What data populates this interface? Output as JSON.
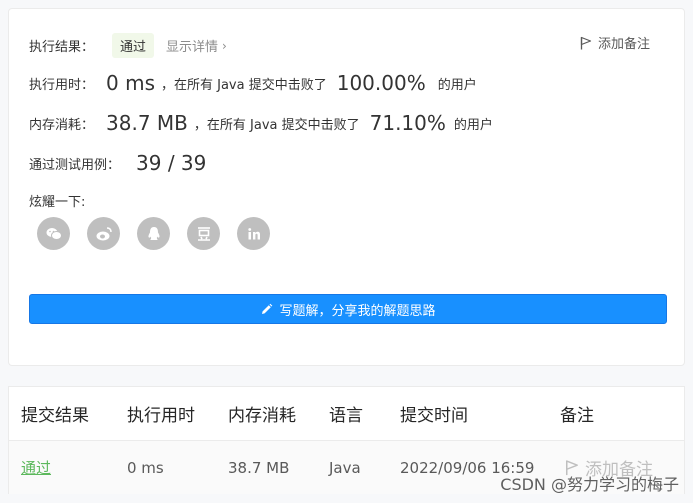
{
  "result": {
    "label": "执行结果：",
    "status": "通过",
    "detail_link": "显示详情",
    "add_note": "添加备注"
  },
  "runtime": {
    "label": "执行用时：",
    "value": "0 ms",
    "middle": "，在所有 Java 提交中击败了",
    "percent": "100.00%",
    "suffix": "的用户"
  },
  "memory": {
    "label": "内存消耗：",
    "value": "38.7 MB",
    "middle": "，在所有 Java 提交中击败了",
    "percent": "71.10%",
    "suffix": "的用户"
  },
  "tests": {
    "label": "通过测试用例：",
    "value": "39 / 39"
  },
  "share": {
    "label": "炫耀一下:",
    "icons": [
      "wechat-icon",
      "weibo-icon",
      "qq-icon",
      "douban-icon",
      "linkedin-icon"
    ]
  },
  "solution_button": "写题解，分享我的解题思路",
  "table": {
    "headers": [
      "提交结果",
      "执行用时",
      "内存消耗",
      "语言",
      "提交时间",
      "备注"
    ],
    "row": {
      "result": "通过",
      "runtime": "0 ms",
      "memory": "38.7 MB",
      "language": "Java",
      "time": "2022/09/06 16:59",
      "note": "添加备注"
    }
  },
  "watermark": "CSDN @努力学习的梅子",
  "colors": {
    "accent": "#1890ff",
    "pass": "#5cb85c",
    "icon_gray": "#bfbfbf"
  }
}
